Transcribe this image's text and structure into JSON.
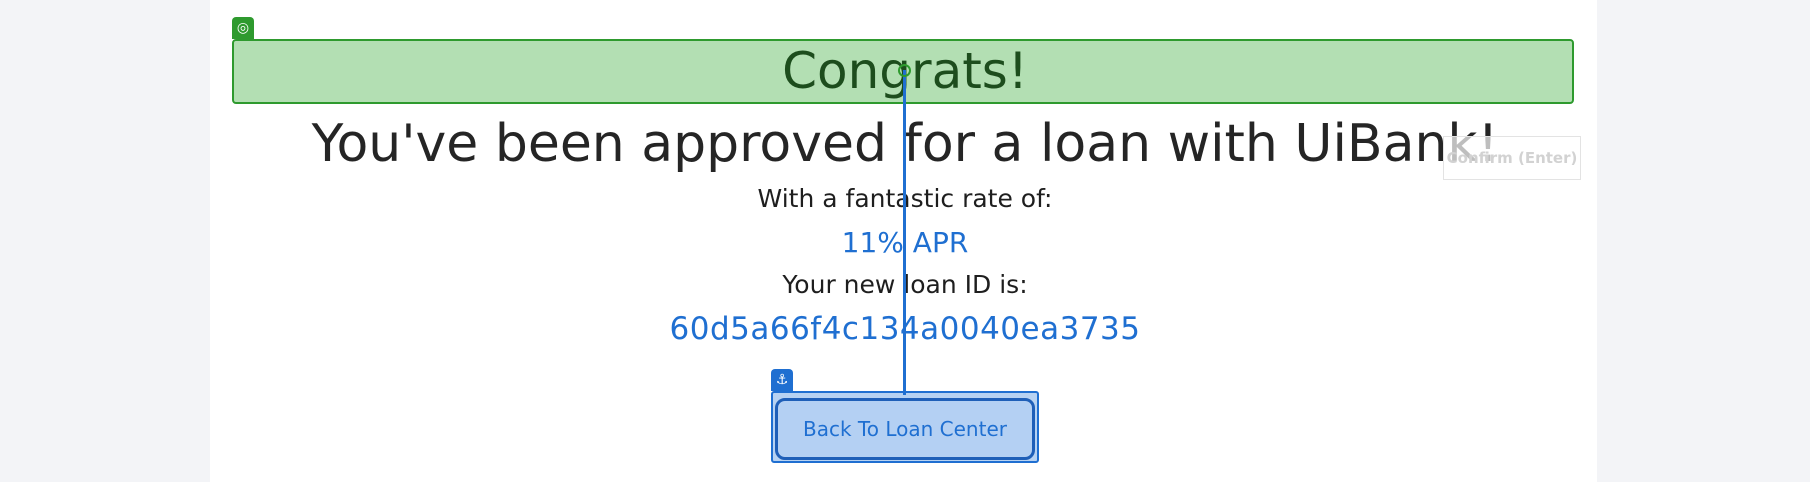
{
  "result": {
    "heading": "Congrats!",
    "approval_message": "You've been approved for a loan with UiBank!",
    "rate_label": "With a fantastic rate of:",
    "rate_value": "11% APR",
    "loan_id_label": "Your new loan ID is:",
    "loan_id_value": "60d5a66f4c134a0040ea3735"
  },
  "actions": {
    "back_button_label": "Back To Loan Center",
    "confirm_label": "Confirm (Enter)"
  },
  "overlay": {
    "target_badge_icon": "target-icon",
    "anchor_badge_icon": "anchor-icon",
    "target_badge_glyph": "◎",
    "anchor_badge_glyph": "⚓"
  },
  "colors": {
    "accent_blue": "#1f6fd1",
    "highlight_green": "#2e9a2e",
    "page_background": "#f3f4f7"
  }
}
